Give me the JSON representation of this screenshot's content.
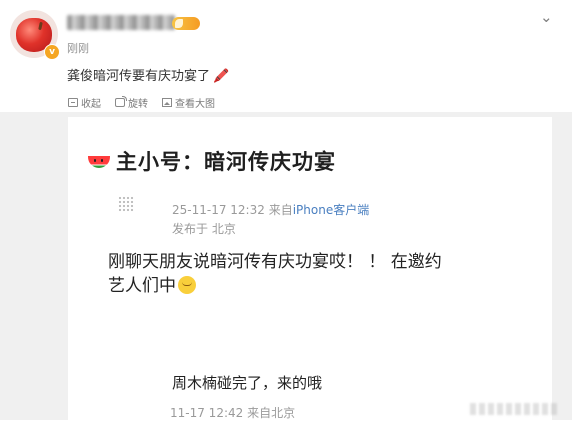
{
  "post": {
    "time": "刚刚",
    "text": "龚俊暗河传要有庆功宴了",
    "text_emoji": "🖍️",
    "verified_badge": "v",
    "actions": {
      "collapse": "收起",
      "rotate": "旋转",
      "view_large": "查看大图"
    }
  },
  "image": {
    "title": "主小号：暗河传庆功宴",
    "meta_date": "25-11-17 12:32",
    "meta_from": "来自",
    "meta_source": "iPhone客户端",
    "meta_location": "发布于 北京",
    "body_line1": "刚聊天朋友说暗河传有庆功宴哎！ ！ 在邀约",
    "body_line2": "艺人们中",
    "body2": "周木楠碰完了，来的哦",
    "meta_bottom": "11-17 12:42 来自北京"
  },
  "colors": {
    "accent_link": "#4a7fc0",
    "badge": "#f5a623",
    "image_bg": "#f0f0f0"
  },
  "icons": [
    "apple-avatar",
    "verified-icon",
    "svip-icon",
    "chevron-down-icon",
    "collapse-icon",
    "rotate-icon",
    "view-large-icon",
    "watermelon-icon",
    "smiley-icon"
  ]
}
